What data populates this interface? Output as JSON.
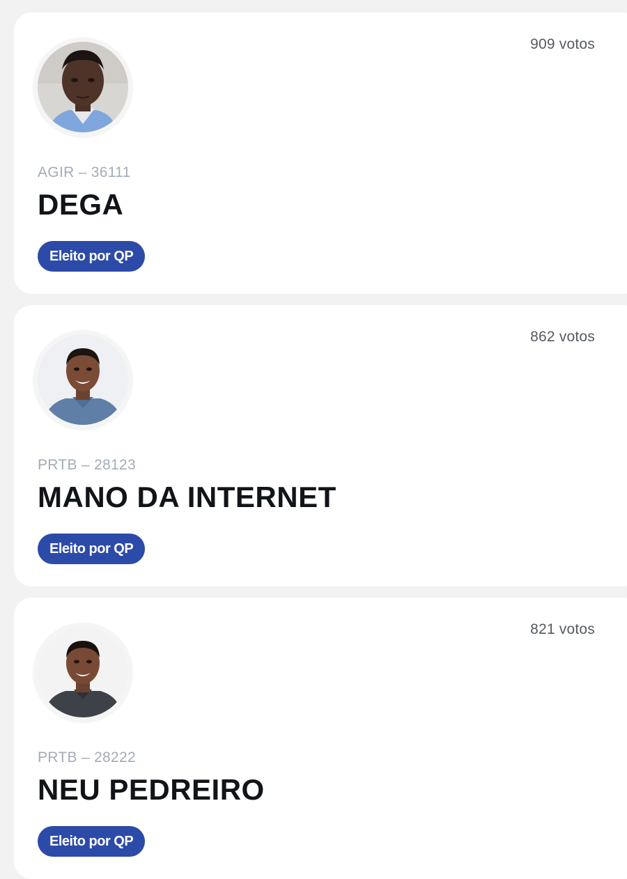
{
  "colors": {
    "page_background": "#f2f2f3",
    "card_background": "#ffffff",
    "badge_background": "#2c4aa8",
    "badge_text": "#ffffff",
    "party_text": "#a3acb8",
    "name_text": "#111418",
    "votes_text": "#555a60"
  },
  "candidates": [
    {
      "votes": "909 votos",
      "party": "AGIR – 36111",
      "name": "DEGA",
      "badge": "Eleito por QP",
      "avatar_icon": "candidate-photo"
    },
    {
      "votes": "862 votos",
      "party": "PRTB – 28123",
      "name": "MANO DA INTERNET",
      "badge": "Eleito por QP",
      "avatar_icon": "candidate-photo"
    },
    {
      "votes": "821 votos",
      "party": "PRTB – 28222",
      "name": "NEU PEDREIRO",
      "badge": "Eleito por QP",
      "avatar_icon": "candidate-photo"
    }
  ]
}
